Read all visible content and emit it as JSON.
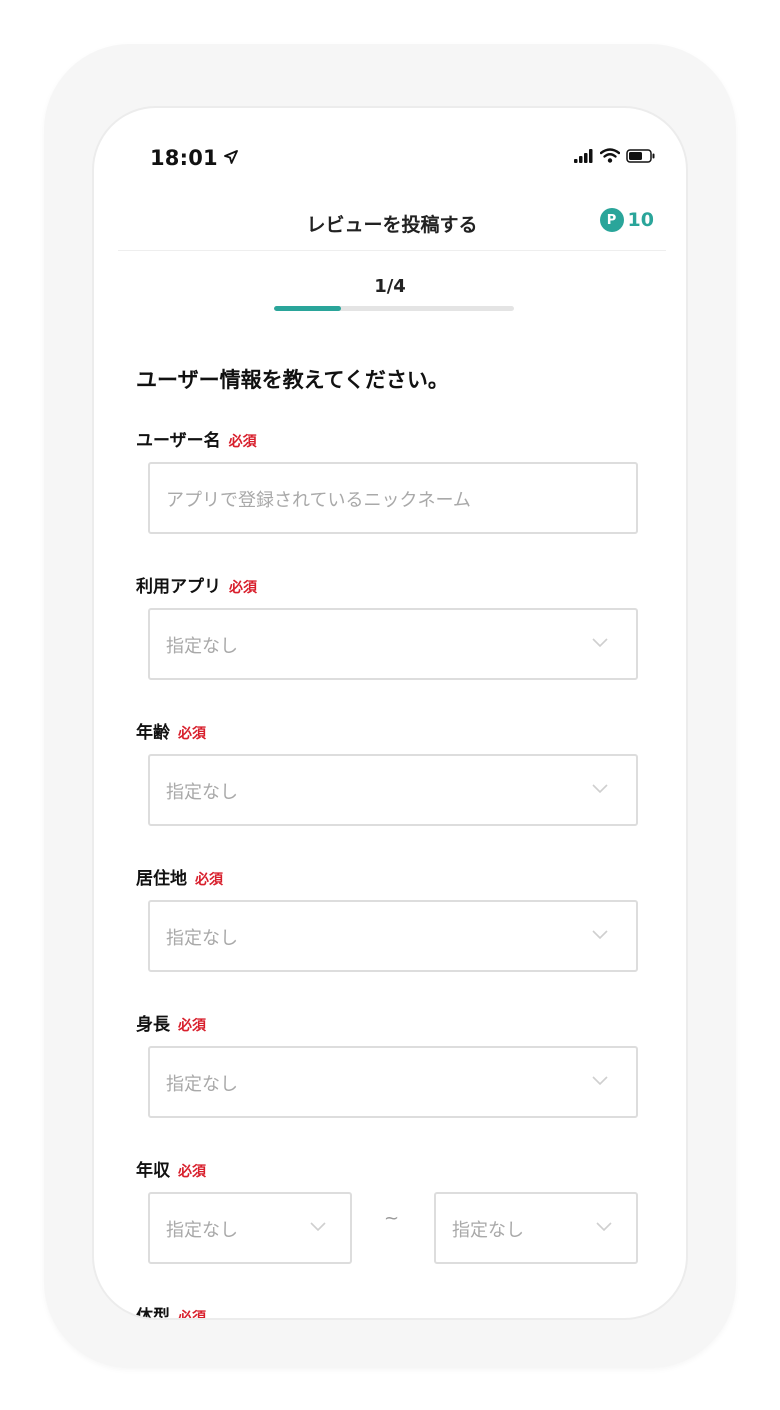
{
  "status_bar": {
    "time": "18:01"
  },
  "header": {
    "title": "レビューを投稿する",
    "points_badge": "P",
    "points": "10"
  },
  "progress": {
    "step_label": "1/4",
    "fraction": 0.28
  },
  "form": {
    "heading": "ユーザー情報を教えてください。",
    "required_label": "必須",
    "username": {
      "label": "ユーザー名",
      "placeholder": "アプリで登録されているニックネーム"
    },
    "app": {
      "label": "利用アプリ",
      "value": "指定なし"
    },
    "age": {
      "label": "年齢",
      "value": "指定なし"
    },
    "residence": {
      "label": "居住地",
      "value": "指定なし"
    },
    "height": {
      "label": "身長",
      "value": "指定なし"
    },
    "income": {
      "label": "年収",
      "min_value": "指定なし",
      "separator": "~",
      "max_value": "指定なし"
    },
    "next_label": {
      "label": "体型",
      "partial": true
    }
  },
  "colors": {
    "accent": "#2aa59a",
    "required": "#d81f2c"
  }
}
